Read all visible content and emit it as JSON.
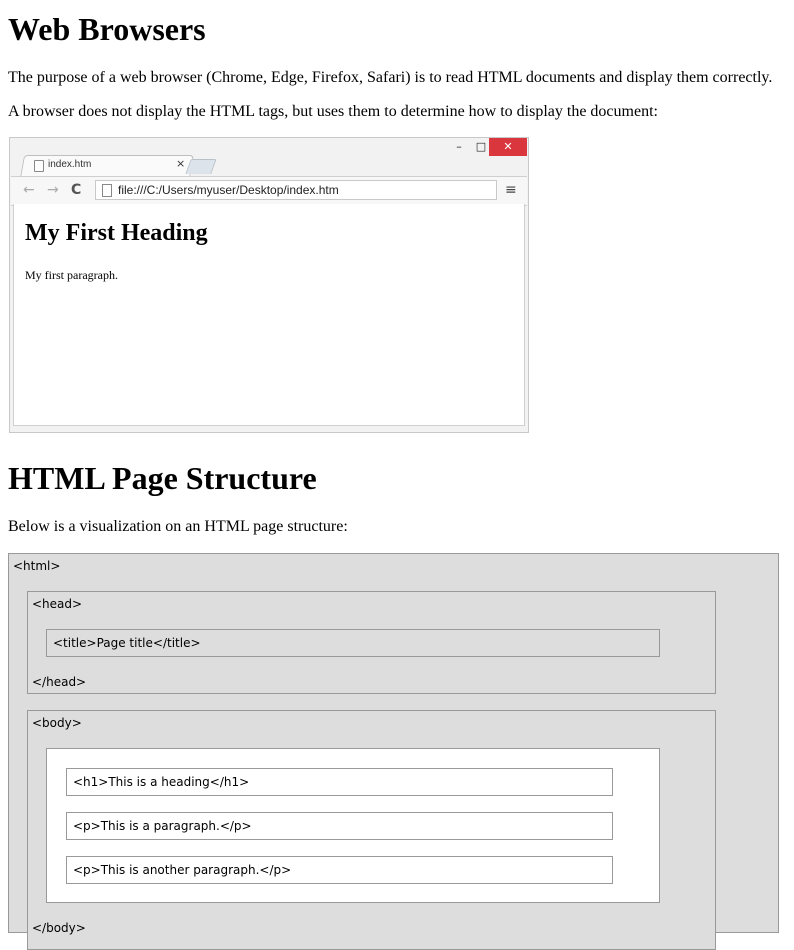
{
  "page": {
    "h_browsers": "Web Browsers",
    "p1": "The purpose of a web browser (Chrome, Edge, Firefox, Safari) is to read HTML documents and display them correctly.",
    "p2": "A browser does not display the HTML tags, but uses them to determine how to display the document:",
    "h_structure": "HTML Page Structure",
    "p3": "Below is a visualization on an HTML page structure:"
  },
  "browser": {
    "tab_label": "index.htm",
    "tab_close": "×",
    "address": "file:///C:/Users/myuser/Desktop/index.htm",
    "btn_min": "–",
    "btn_max": "□",
    "btn_close": "✕",
    "nav_back": "←",
    "nav_forward": "→",
    "nav_reload": "C",
    "menu": "≡",
    "content_heading": "My First Heading",
    "content_paragraph": "My first paragraph."
  },
  "structure": {
    "html_open": "<html>",
    "head_open": "<head>",
    "title": "<title>Page title</title>",
    "head_close": "</head>",
    "body_open": "<body>",
    "h1": "<h1>This is a heading</h1>",
    "p1": "<p>This is a paragraph.</p>",
    "p2": "<p>This is another paragraph.</p>",
    "body_close": "</body>"
  },
  "colors": {
    "close_button": "#d9363e",
    "diagram_gray": "#dddddd"
  }
}
